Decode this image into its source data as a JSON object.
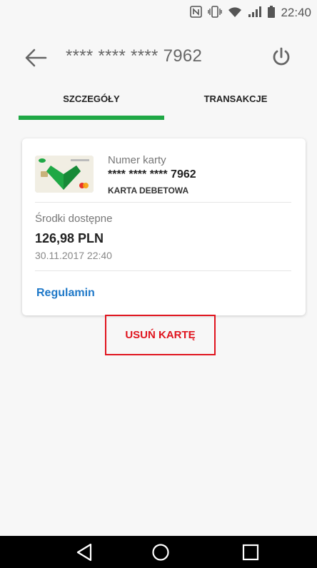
{
  "status_bar": {
    "time": "22:40",
    "icons": [
      "nfc-icon",
      "vibrate-icon",
      "wifi-icon",
      "signal-icon",
      "battery-icon"
    ]
  },
  "toolbar": {
    "title": "**** **** **** 7962"
  },
  "tabs": [
    {
      "label": "SZCZEGÓŁY",
      "active": true
    },
    {
      "label": "TRANSAKCJE",
      "active": false
    }
  ],
  "card": {
    "number_label": "Numer karty",
    "number_value": "**** **** **** 7962",
    "type": "KARTA DEBETOWA",
    "funds_label": "Środki dostępne",
    "funds_value": "126,98 PLN",
    "funds_date": "30.11.2017 22:40",
    "terms_link": "Regulamin"
  },
  "remove_button": {
    "label": "USUŃ KARTĘ"
  },
  "colors": {
    "accent_green": "#1fa845",
    "link_blue": "#1e78c8",
    "danger_red": "#e0141e"
  }
}
